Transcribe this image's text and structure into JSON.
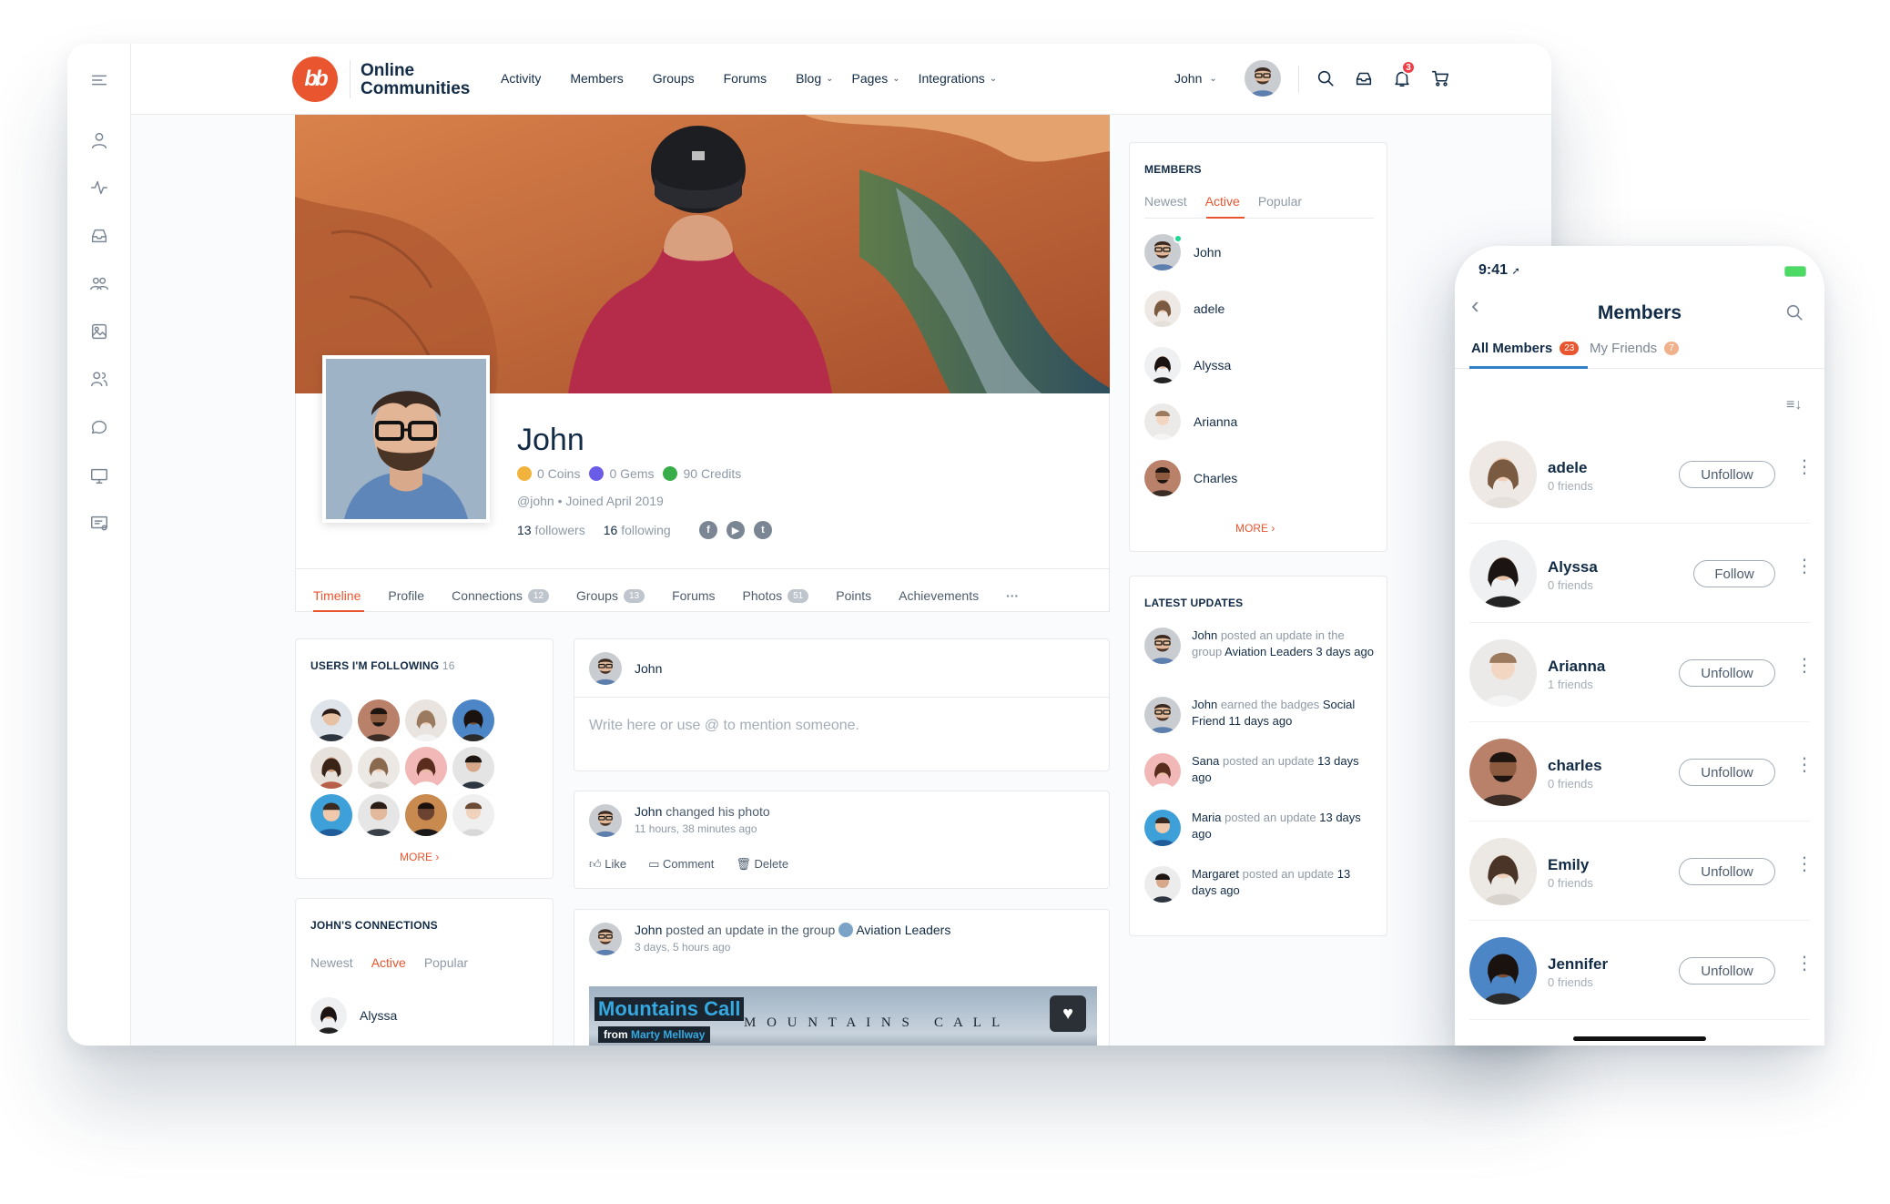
{
  "topbar": {
    "brand_line1": "Online",
    "brand_line2": "Communities",
    "nav": [
      "Activity",
      "Members",
      "Groups",
      "Forums",
      "Blog",
      "Pages",
      "Integrations"
    ],
    "user_name": "John",
    "notification_count": "3"
  },
  "profile": {
    "name": "John",
    "coins": "0 Coins",
    "gems": "0 Gems",
    "credits": "90 Credits",
    "handle": "@john • Joined April 2019",
    "followers_count": "13",
    "followers_label": "followers",
    "following_count": "16",
    "following_label": "following",
    "tabs": [
      {
        "label": "Timeline",
        "count": ""
      },
      {
        "label": "Profile",
        "count": ""
      },
      {
        "label": "Connections",
        "count": "12"
      },
      {
        "label": "Groups",
        "count": "13"
      },
      {
        "label": "Forums",
        "count": ""
      },
      {
        "label": "Photos",
        "count": "51"
      },
      {
        "label": "Points",
        "count": ""
      },
      {
        "label": "Achievements",
        "count": ""
      }
    ],
    "more_tabs": "···"
  },
  "following_widget": {
    "title": "USERS I'M FOLLOWING",
    "count": "16",
    "more": "MORE"
  },
  "connections_widget": {
    "title": "JOHN'S CONNECTIONS",
    "tabs": [
      "Newest",
      "Active",
      "Popular"
    ],
    "first_member": "Alyssa"
  },
  "composer": {
    "author": "John",
    "placeholder": "Write here or use @ to mention someone."
  },
  "post1": {
    "author": "John",
    "action": "changed his photo",
    "time": "11 hours, 38 minutes ago",
    "like": "Like",
    "comment": "Comment",
    "delete": "Delete"
  },
  "post2": {
    "author": "John",
    "action": "posted an update in the group",
    "group": "Aviation Leaders",
    "time": "3 days, 5 hours ago",
    "media_title": "Mountains Call",
    "media_sub_prefix": "from",
    "media_sub_author": "Marty Mellway",
    "media_overlay": "M O U N T A I N S   C A L L"
  },
  "members_widget": {
    "title": "MEMBERS",
    "tabs": [
      "Newest",
      "Active",
      "Popular"
    ],
    "members": [
      "John",
      "adele",
      "Alyssa",
      "Arianna",
      "Charles"
    ],
    "more": "MORE"
  },
  "updates_widget": {
    "title": "LATEST UPDATES",
    "items": [
      {
        "name": "John",
        "text": "posted an update in the group",
        "tail": "Aviation Leaders 3 days ago"
      },
      {
        "name": "John",
        "text": "earned the badges",
        "tail": "Social Friend 11 days ago"
      },
      {
        "name": "Sana",
        "text": "posted an update",
        "tail": "13 days ago"
      },
      {
        "name": "Maria",
        "text": "posted an update",
        "tail": "13 days ago"
      },
      {
        "name": "Margaret",
        "text": "posted an update",
        "tail": "13 days ago"
      }
    ]
  },
  "phone": {
    "time": "9:41",
    "title": "Members",
    "tab_all": "All Members",
    "tab_all_count": "23",
    "tab_friends": "My Friends",
    "tab_friends_count": "7",
    "members": [
      {
        "name": "adele",
        "friends": "0 friends",
        "button": "Unfollow"
      },
      {
        "name": "Alyssa",
        "friends": "0 friends",
        "button": "Follow"
      },
      {
        "name": "Arianna",
        "friends": "1 friends",
        "button": "Unfollow"
      },
      {
        "name": "charles",
        "friends": "0 friends",
        "button": "Unfollow"
      },
      {
        "name": "Emily",
        "friends": "0 friends",
        "button": "Unfollow"
      },
      {
        "name": "Jennifer",
        "friends": "0 friends",
        "button": "Unfollow"
      }
    ]
  },
  "colors": {
    "accent": "#e8552f",
    "text": "#122b46",
    "muted": "#8e99a6",
    "notification": "#ef3e46"
  }
}
